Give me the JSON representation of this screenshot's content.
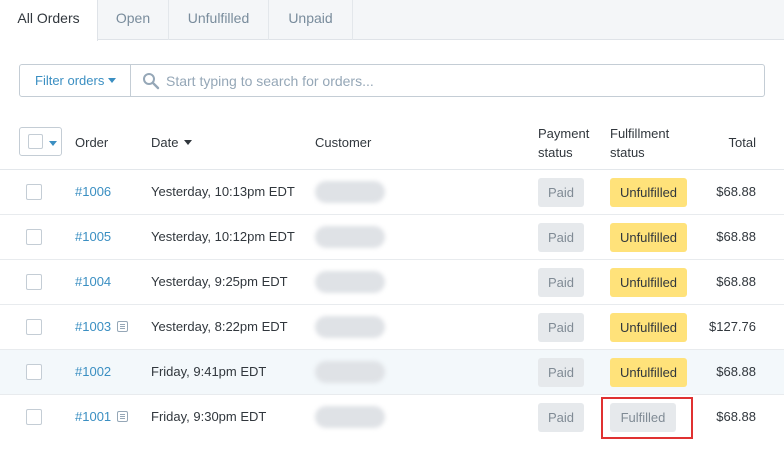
{
  "tabs": [
    {
      "label": "All Orders",
      "active": true
    },
    {
      "label": "Open",
      "active": false
    },
    {
      "label": "Unfulfilled",
      "active": false
    },
    {
      "label": "Unpaid",
      "active": false
    }
  ],
  "filter": {
    "button_label": "Filter orders",
    "search_placeholder": "Start typing to search for orders..."
  },
  "table": {
    "headers": {
      "order": "Order",
      "date": "Date",
      "customer": "Customer",
      "payment_line1": "Payment",
      "payment_line2": "status",
      "fulfillment_line1": "Fulfillment",
      "fulfillment_line2": "status",
      "total": "Total"
    },
    "rows": [
      {
        "order": "#1006",
        "date": "Yesterday, 10:13pm EDT",
        "payment": "Paid",
        "fulfillment": "Unfulfilled",
        "total": "$68.88",
        "has_note": false
      },
      {
        "order": "#1005",
        "date": "Yesterday, 10:12pm EDT",
        "payment": "Paid",
        "fulfillment": "Unfulfilled",
        "total": "$68.88",
        "has_note": false
      },
      {
        "order": "#1004",
        "date": "Yesterday, 9:25pm EDT",
        "payment": "Paid",
        "fulfillment": "Unfulfilled",
        "total": "$68.88",
        "has_note": false
      },
      {
        "order": "#1003",
        "date": "Yesterday, 8:22pm EDT",
        "payment": "Paid",
        "fulfillment": "Unfulfilled",
        "total": "$127.76",
        "has_note": true
      },
      {
        "order": "#1002",
        "date": "Friday, 9:41pm EDT",
        "payment": "Paid",
        "fulfillment": "Unfulfilled",
        "total": "$68.88",
        "has_note": false
      },
      {
        "order": "#1001",
        "date": "Friday, 9:30pm EDT",
        "payment": "Paid",
        "fulfillment": "Fulfilled",
        "total": "$68.88",
        "has_note": true
      }
    ]
  },
  "colors": {
    "link": "#3b8fc2",
    "unfulfilled_badge": "#ffe27a",
    "neutral_badge": "#e6e9ec",
    "callout_border": "#e03131"
  }
}
